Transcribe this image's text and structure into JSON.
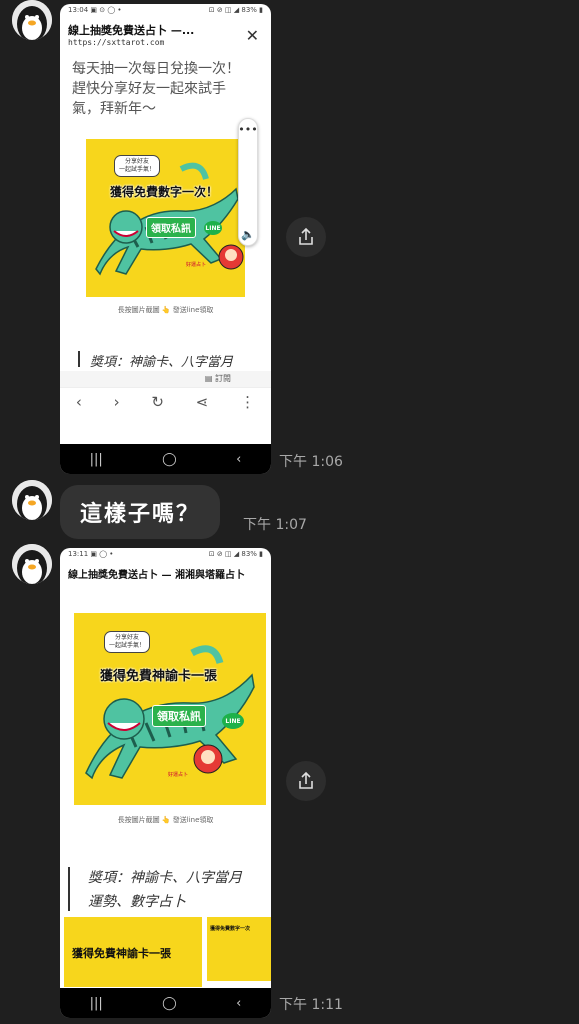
{
  "messages": [
    {
      "time": "下午 1:06"
    },
    {
      "text": "這樣子嗎？",
      "time": "下午 1:07"
    },
    {
      "time": "下午 1:11"
    }
  ],
  "shot1": {
    "status_left": "13:04 ▣ ⊙ ◯ •",
    "status_right": "⊡ ⊘ ◫ ◢ 83% ▮",
    "page_title": "線上抽獎免費送占卜 —...",
    "url": "https://sxttarot.com",
    "promo": "每天抽一次每日兌換一次！趕快分享好友一起來試手氣，拜新年～",
    "tag": "分享好友\n一起試手氣！",
    "headline": "獲得免費數字一次！",
    "claim": "領取私訊",
    "line": "LINE",
    "brand": "好運占卜",
    "caption": "長按圖片截圖 👆 發送line領取",
    "prize": "獎項：神諭卡、八字當月",
    "subscribe": "訂閱"
  },
  "shot2": {
    "status_left": "13:11 ▣ ◯ •",
    "status_right": "⊡ ⊘ ◫ ◢ 83% ▮",
    "page_title": "線上抽獎免費送占卜 — 湘湘與塔羅占卜",
    "tag": "分享好友\n一起試手氣！",
    "headline": "獲得免費神諭卡一張",
    "claim": "領取私訊",
    "line": "LINE",
    "brand": "好運占卜",
    "caption": "長按圖片截圖 👆 發送line領取",
    "prize_line1": "獎項：神諭卡、八字當月",
    "prize_line2": "運勢、數字占卜",
    "thumb_headline": "獲得免費神諭卡一張",
    "thumb_small_headline": "獲得免費數字一次"
  }
}
